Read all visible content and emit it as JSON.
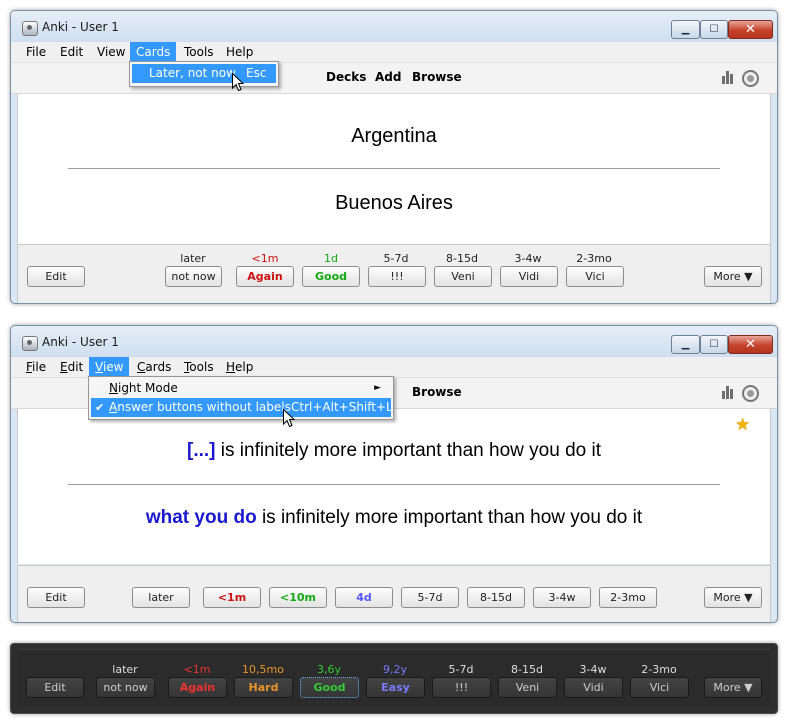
{
  "window_title": "Anki - User 1",
  "menu": {
    "file": "File",
    "edit": "Edit",
    "view": "View",
    "cards": "Cards",
    "tools": "Tools",
    "help": "Help"
  },
  "toolbar": {
    "decks": "Decks",
    "add": "Add",
    "browse": "Browse"
  },
  "window1": {
    "cards_menu": {
      "item": "Later, not now",
      "shortcut": "Esc"
    },
    "question": "Argentina",
    "answer": "Buenos Aires",
    "edit": "Edit",
    "more": "More ▼",
    "buttons": [
      {
        "interval": "later",
        "label": "not now"
      },
      {
        "interval": "<1m",
        "label": "Again"
      },
      {
        "interval": "1d",
        "label": "Good"
      },
      {
        "interval": "5-7d",
        "label": "!!!"
      },
      {
        "interval": "8-15d",
        "label": "Veni"
      },
      {
        "interval": "3-4w",
        "label": "Vidi"
      },
      {
        "interval": "2-3mo",
        "label": "Vici"
      }
    ]
  },
  "window2": {
    "view_menu": {
      "night_mode": "Night Mode",
      "answer_buttons": "Answer buttons without labels",
      "answer_buttons_shortcut": "Ctrl+Alt+Shift+L",
      "check": "✔",
      "submenu_arrow": "►"
    },
    "question_cloze": "[...]",
    "question_rest": " is infinitely more important than how you do it",
    "answer_cloze": "what you do",
    "answer_rest": " is infinitely more important than how you do it",
    "edit": "Edit",
    "more": "More ▼",
    "buttons": [
      "later",
      "<1m",
      "<10m",
      "4d",
      "5-7d",
      "8-15d",
      "3-4w",
      "2-3mo"
    ]
  },
  "window3": {
    "edit": "Edit",
    "more": "More ▼",
    "buttons": [
      {
        "interval": "later",
        "label": "not now"
      },
      {
        "interval": "<1m",
        "label": "Again"
      },
      {
        "interval": "10,5mo",
        "label": "Hard"
      },
      {
        "interval": "3,6y",
        "label": "Good"
      },
      {
        "interval": "9,2y",
        "label": "Easy"
      },
      {
        "interval": "5-7d",
        "label": "!!!"
      },
      {
        "interval": "8-15d",
        "label": "Veni"
      },
      {
        "interval": "3-4w",
        "label": "Vidi"
      },
      {
        "interval": "2-3mo",
        "label": "Vici"
      }
    ]
  },
  "icons": {
    "minimize": "▁",
    "maximize": "☐",
    "close": "✕",
    "stats": "stats-icon",
    "sync": "sync-icon",
    "star": "★",
    "cursor": "cursor-icon"
  },
  "colors": {
    "accent": "#3399ff",
    "again": "#cc1111",
    "good": "#11aa11",
    "easy": "#5555ff",
    "hard": "#e8942a"
  }
}
